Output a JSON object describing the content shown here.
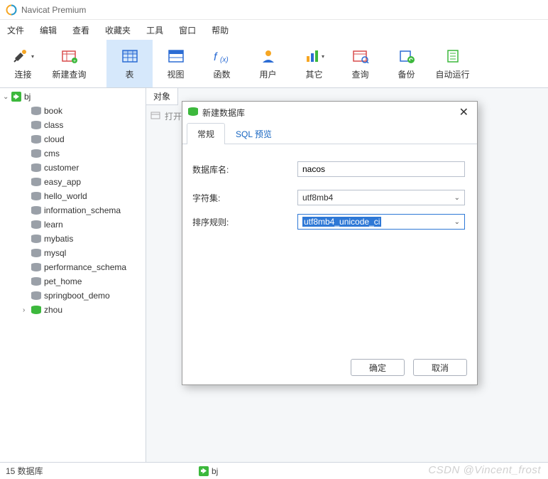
{
  "title": "Navicat Premium",
  "menus": [
    "文件",
    "编辑",
    "查看",
    "收藏夹",
    "工具",
    "窗口",
    "帮助"
  ],
  "toolbar": [
    {
      "label": "连接",
      "icon": "plug",
      "drop": true
    },
    {
      "label": "新建查询",
      "icon": "table-new"
    },
    {
      "label": "表",
      "icon": "table",
      "active": true
    },
    {
      "label": "视图",
      "icon": "view"
    },
    {
      "label": "函数",
      "icon": "fx"
    },
    {
      "label": "用户",
      "icon": "user"
    },
    {
      "label": "其它",
      "icon": "other",
      "drop": true
    },
    {
      "label": "查询",
      "icon": "query"
    },
    {
      "label": "备份",
      "icon": "backup"
    },
    {
      "label": "自动运行",
      "icon": "auto"
    }
  ],
  "tree": {
    "root": "bj",
    "children": [
      "book",
      "class",
      "cloud",
      "cms",
      "customer",
      "easy_app",
      "hello_world",
      "information_schema",
      "learn",
      "mybatis",
      "mysql",
      "performance_schema",
      "pet_home",
      "springboot_demo",
      "zhou"
    ]
  },
  "content_tab": "对象",
  "content_toolbar_action": "打开",
  "dialog": {
    "title": "新建数据库",
    "tabs": [
      "常规",
      "SQL 预览"
    ],
    "active_tab": "常规",
    "fields": {
      "db_name_label": "数据库名:",
      "db_name_value": "nacos",
      "charset_label": "字符集:",
      "charset_value": "utf8mb4",
      "collation_label": "排序规则:",
      "collation_value": "utf8mb4_unicode_ci"
    },
    "buttons": {
      "ok": "确定",
      "cancel": "取消"
    }
  },
  "status": {
    "left": "15 数据库",
    "mid": "bj"
  },
  "watermark": "CSDN @Vincent_frost"
}
